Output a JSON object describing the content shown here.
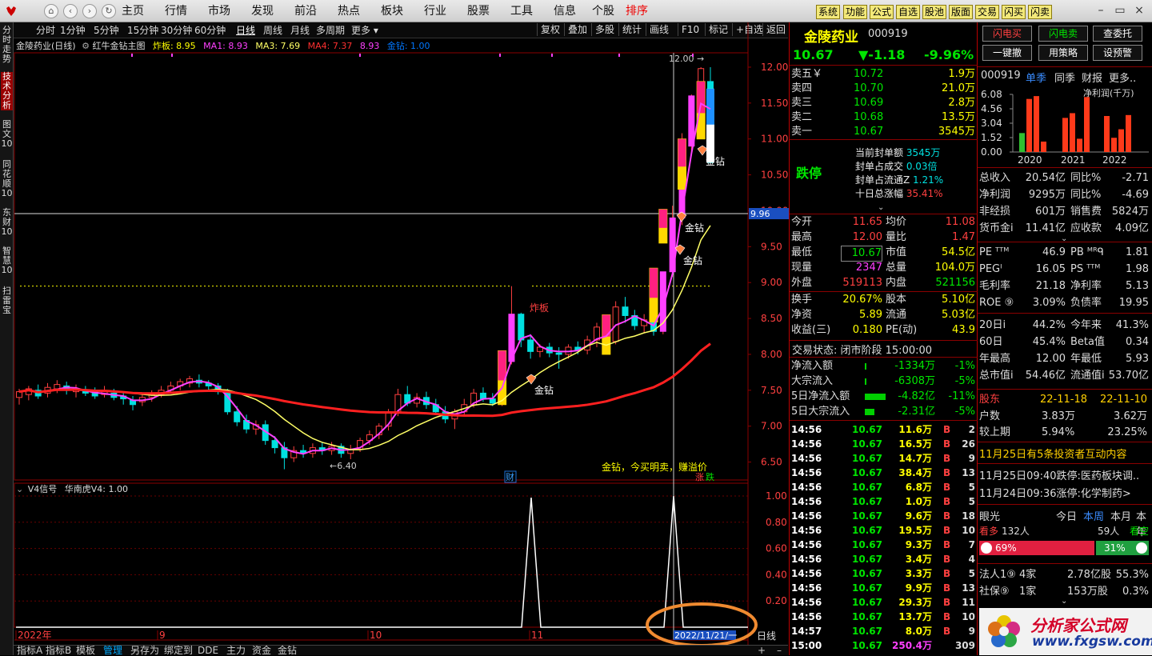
{
  "topbar": {
    "nav": [
      "主页",
      "行情",
      "市场",
      "发现",
      "前沿",
      "热点",
      "板块",
      "行业",
      "股票",
      "工具",
      "信息",
      "个股",
      "排序"
    ],
    "active_nav": "排序",
    "yellow_buttons": [
      "系统",
      "功能",
      "公式",
      "自选",
      "股池",
      "版面",
      "交易",
      "闪买",
      "闪卖"
    ]
  },
  "leftbar": {
    "tabs": [
      "分时走势",
      "技术分析",
      "图文10",
      "同花顺10",
      "东财10",
      "智慧10",
      "扫雷宝"
    ]
  },
  "chart_toolbar": {
    "periods": [
      "分时",
      "1分钟",
      "5分钟",
      "15分钟",
      "30分钟",
      "60分钟",
      "日线",
      "周线",
      "月线",
      "多周期",
      "更多"
    ],
    "active_period": "日线",
    "right_tools": [
      "复权",
      "叠加",
      "多股",
      "统计",
      "画线",
      "F10",
      "标记",
      "+自选",
      "返回"
    ]
  },
  "main_chart": {
    "stock_label": "金陵药业(日线)",
    "indicator_name": "红牛金钻主图",
    "ind_zhaban": "炸板: 8.95",
    "ma1": "MA1: 8.93",
    "ma3": "MA3: 7.69",
    "ma4": "MA4: 7.37",
    "ma_extra": "8.93",
    "jinzuan": "金钻: 1.00",
    "y_ticks": [
      "12.00",
      "11.50",
      "11.00",
      "10.50",
      "10.00",
      "9.50",
      "9.00",
      "8.50",
      "8.00",
      "7.50",
      "7.00",
      "6.50"
    ],
    "current_price_tag": "9.96",
    "high_label": "12.00",
    "low_label": "6.40",
    "zhaban_label": "炸板",
    "jinzuan_labels": [
      "金钻",
      "金钻",
      "金钻",
      "金钻"
    ],
    "legend_text": "金钻，今买明卖，赚溢价",
    "cai_tag": "财",
    "zhang": "涨",
    "die": "跌"
  },
  "sub_chart": {
    "title": "V4信号",
    "name": "华南虎V4: 1.00",
    "y_ticks": [
      "1.00",
      "0.80",
      "0.60",
      "0.40",
      "0.20"
    ]
  },
  "x_axis": {
    "labels": [
      "2022年",
      "9",
      "10",
      "11"
    ],
    "cursor_date": "2022/11/21/一",
    "period": "日线"
  },
  "bottom_tabs": [
    "指标A",
    "指标B",
    "模板",
    "管理",
    "另存为",
    "绑定到",
    "DDE",
    "主力",
    "资金",
    "金钻"
  ],
  "quote": {
    "name": "金陵药业",
    "code": "000919",
    "price": "10.67",
    "change": "▼-1.18",
    "pct": "-9.96%",
    "asks": [
      {
        "label": "卖五￥",
        "price": "10.72",
        "vol": "1.9万"
      },
      {
        "label": "卖四",
        "price": "10.70",
        "vol": "21.0万"
      },
      {
        "label": "卖三",
        "price": "10.69",
        "vol": "2.8万"
      },
      {
        "label": "卖二",
        "price": "10.68",
        "vol": "13.5万"
      },
      {
        "label": "卖一",
        "price": "10.67",
        "vol": "3545万"
      }
    ],
    "limit_status": "跌停",
    "seal_info": [
      {
        "label": "当前封单额",
        "value": "3545万"
      },
      {
        "label": "封单占成交",
        "value": "0.03倍"
      },
      {
        "label": "封单占流通Z",
        "value": "1.21%"
      },
      {
        "label": "十日总涨幅",
        "value": "35.41%"
      }
    ],
    "stats": [
      {
        "l1": "今开",
        "v1": "11.65",
        "l2": "均价",
        "v2": "11.08"
      },
      {
        "l1": "最高",
        "v1": "12.00",
        "l2": "量比",
        "v2": "1.47"
      },
      {
        "l1": "最低",
        "v1": "10.67",
        "l2": "市值",
        "v2": "54.5亿"
      },
      {
        "l1": "现量",
        "v1": "2347",
        "l2": "总量",
        "v2": "104.0万"
      },
      {
        "l1": "外盘",
        "v1": "519113",
        "l2": "内盘",
        "v2": "521156"
      }
    ],
    "stats2": [
      {
        "l1": "换手",
        "v1": "20.67%",
        "l2": "股本",
        "v2": "5.10亿"
      },
      {
        "l1": "净资",
        "v1": "5.89",
        "l2": "流通",
        "v2": "5.03亿"
      },
      {
        "l1": "收益(三)",
        "v1": "0.180",
        "l2": "PE(动)",
        "v2": "43.9"
      }
    ],
    "trade_status": "交易状态: 闭市阶段 15:00:00",
    "flows": [
      {
        "label": "净流入额",
        "value": "-1334万",
        "pct": "-1%"
      },
      {
        "label": "大宗流入",
        "value": "-6308万",
        "pct": "-5%"
      },
      {
        "label": "5日净流入额",
        "value": "-4.82亿",
        "pct": "-11%"
      },
      {
        "label": "5日大宗流入",
        "value": "-2.31亿",
        "pct": "-5%"
      }
    ],
    "ticks": [
      {
        "t": "14:56",
        "p": "10.67",
        "v": "11.6万",
        "d": "B",
        "n": "2"
      },
      {
        "t": "14:56",
        "p": "10.67",
        "v": "16.5万",
        "d": "B",
        "n": "26"
      },
      {
        "t": "14:56",
        "p": "10.67",
        "v": "14.7万",
        "d": "B",
        "n": "9"
      },
      {
        "t": "14:56",
        "p": "10.67",
        "v": "38.4万",
        "d": "B",
        "n": "13"
      },
      {
        "t": "14:56",
        "p": "10.67",
        "v": "6.8万",
        "d": "B",
        "n": "5"
      },
      {
        "t": "14:56",
        "p": "10.67",
        "v": "1.0万",
        "d": "B",
        "n": "5"
      },
      {
        "t": "14:56",
        "p": "10.67",
        "v": "9.6万",
        "d": "B",
        "n": "18"
      },
      {
        "t": "14:56",
        "p": "10.67",
        "v": "19.5万",
        "d": "B",
        "n": "10"
      },
      {
        "t": "14:56",
        "p": "10.67",
        "v": "9.3万",
        "d": "B",
        "n": "7"
      },
      {
        "t": "14:56",
        "p": "10.67",
        "v": "3.4万",
        "d": "B",
        "n": "4"
      },
      {
        "t": "14:56",
        "p": "10.67",
        "v": "3.3万",
        "d": "B",
        "n": "5"
      },
      {
        "t": "14:56",
        "p": "10.67",
        "v": "9.9万",
        "d": "B",
        "n": "13"
      },
      {
        "t": "14:56",
        "p": "10.67",
        "v": "29.3万",
        "d": "B",
        "n": "11"
      },
      {
        "t": "14:56",
        "p": "10.67",
        "v": "13.7万",
        "d": "B",
        "n": "10"
      },
      {
        "t": "14:57",
        "p": "10.67",
        "v": "8.0万",
        "d": "B",
        "n": "9"
      },
      {
        "t": "15:00",
        "p": "10.67",
        "v": "250.4万",
        "d": "",
        "n": "309"
      }
    ]
  },
  "fin": {
    "buttons": [
      "闪电买",
      "闪电卖",
      "查委托",
      "一键撤",
      "用策略",
      "设预警"
    ],
    "code": "000919",
    "tabs": [
      "单季",
      "同季",
      "财报",
      "更多.."
    ],
    "chart_title": "净利润(千万)",
    "chart_yticks": [
      "6.08",
      "4.56",
      "3.04",
      "1.52",
      "0.00"
    ],
    "chart_years": [
      "2020",
      "2021",
      "2022"
    ],
    "chart_data": {
      "type": "bar",
      "categories": [
        "2020",
        "2021",
        "2022"
      ],
      "series": [
        {
          "name": "净利润(千万)",
          "values": [
            [
              2.0,
              5.6,
              5.9,
              1.1
            ],
            [
              3.6,
              4.1,
              1.4,
              5.8
            ],
            [
              3.8,
              1.5,
              2.4,
              3.9
            ]
          ]
        }
      ],
      "ylim": [
        0,
        6.08
      ]
    },
    "rows": [
      {
        "l1": "总收入",
        "v1": "20.54亿",
        "l2": "同比%",
        "v2": "-2.71"
      },
      {
        "l1": "净利润",
        "v1": "9295万",
        "l2": "同比%",
        "v2": "-4.69"
      },
      {
        "l1": "非经损",
        "v1": "601万",
        "l2": "销售费",
        "v2": "5824万"
      },
      {
        "l1": "货币金i",
        "v1": "11.41亿",
        "l2": "应收款",
        "v2": "4.09亿"
      }
    ],
    "rows2": [
      {
        "l1": "PE ᵀᵀᴹ",
        "v1": "46.9",
        "l2": "PB ᴹᴿᑫ",
        "v2": "1.81"
      },
      {
        "l1": "PEGᴵ",
        "v1": "16.05",
        "l2": "PS ᵀᵀᴹ",
        "v2": "1.98"
      },
      {
        "l1": "毛利率",
        "v1": "21.18",
        "l2": "净利率",
        "v2": "5.13"
      },
      {
        "l1": "ROE ⑨",
        "v1": "3.09%",
        "l2": "负债率",
        "v2": "19.95"
      }
    ],
    "rows3": [
      {
        "l1": "20日i",
        "v1": "44.2%",
        "l2": "今年来",
        "v2": "41.3%"
      },
      {
        "l1": "60日",
        "v1": "45.4%",
        "l2": "Beta值",
        "v2": "0.34"
      },
      {
        "l1": "年最高",
        "v1": "12.00",
        "l2": "年最低",
        "v2": "5.93"
      },
      {
        "l1": "总市值i",
        "v1": "54.46亿",
        "l2": "流通值i",
        "v2": "53.70亿"
      }
    ],
    "holders": {
      "label": "股东",
      "d1": "22-11-18",
      "d2": "22-11-10",
      "rows": [
        {
          "l": "户数",
          "v1": "3.83万",
          "v2": "3.62万"
        },
        {
          "l": "较上期",
          "v1": "5.94%",
          "v2": "23.25%"
        }
      ]
    },
    "news_head": "11月25日有5条投资者互动内容",
    "news": [
      "11月25日09:40跌停:医药板块调..",
      "11月24日09:36涨停:化学制药>"
    ],
    "eye": {
      "label": "眼光",
      "tabs": [
        "今日",
        "本周",
        "本月",
        "本年"
      ]
    },
    "eye_more": "看多",
    "eye_more_n": "132人",
    "eye_less_n": "59人",
    "eye_less": "看空",
    "bull_pct": "69%",
    "bear_pct": "31%",
    "bull_share": 0.69,
    "inst": [
      {
        "l": "法人1⑨",
        "n": "4家",
        "v": "2.78亿股",
        "p": "55.3%"
      },
      {
        "l": "社保⑨",
        "n": "1家",
        "v": "153万股",
        "p": "0.3%"
      }
    ],
    "watermark_cn": "分析家公式网",
    "watermark_url": "www.fxgsw.com"
  }
}
